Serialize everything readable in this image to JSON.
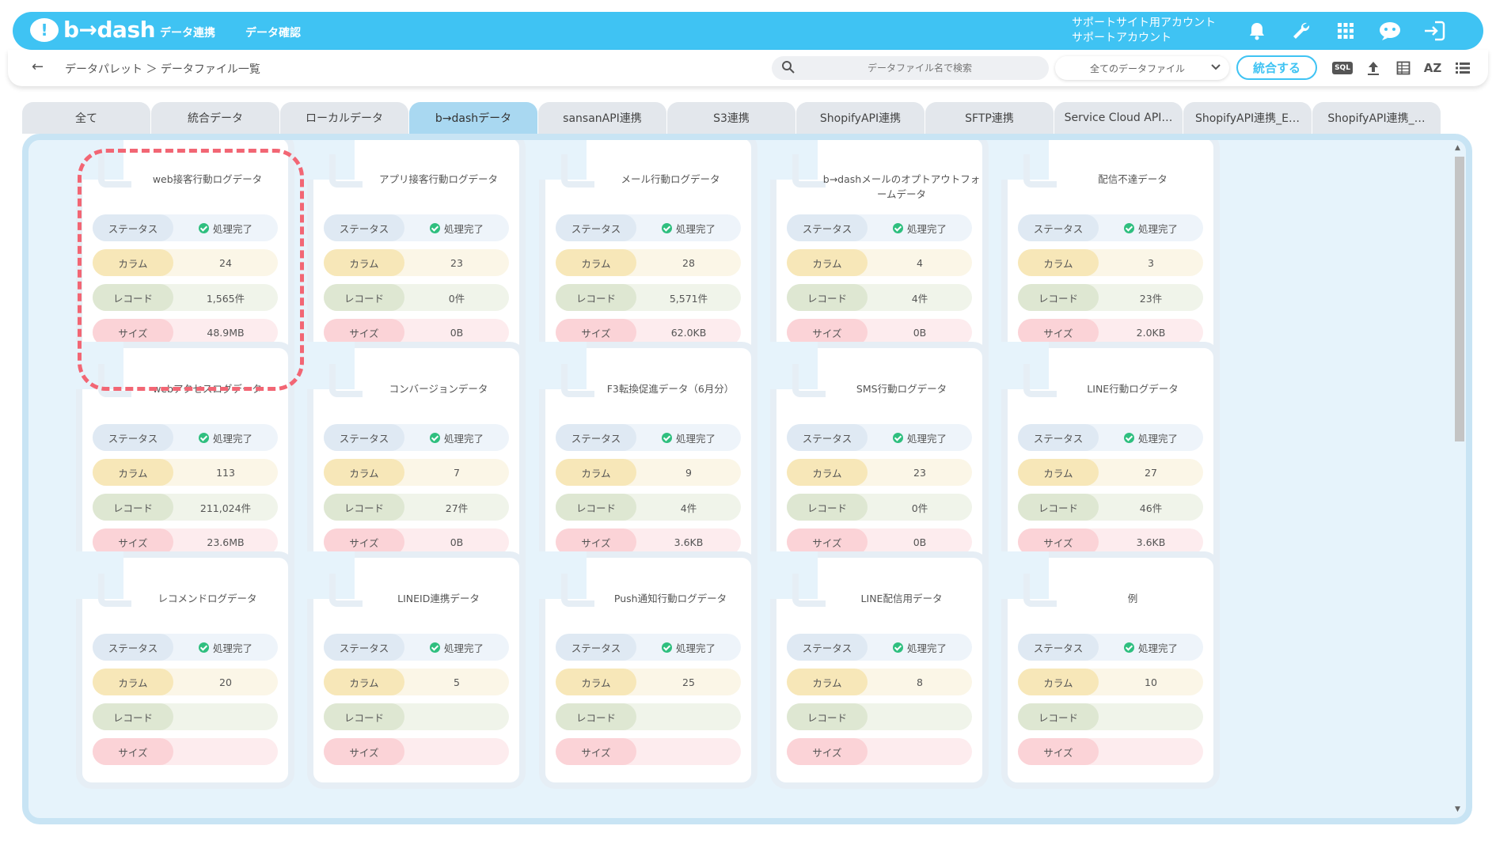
{
  "header": {
    "logo_mark": "!",
    "logo": "b→dash",
    "nav": [
      "データ連携",
      "データ確認"
    ],
    "account_line1": "サポートサイト用アカウント",
    "account_line2": "サポートアカウント",
    "icons": [
      "bell-icon",
      "wrench-icon",
      "grid-icon",
      "chat-bot-icon",
      "logout-icon"
    ]
  },
  "toolbar": {
    "breadcrumb": "データパレット ＞ データファイル一覧",
    "search_placeholder": "データファイル名で検索",
    "filter_selected": "全てのデータファイル",
    "merge_label": "統合する",
    "sql_label": "SQL",
    "sort_label": "AZ",
    "icons": [
      "sql-icon",
      "upload-icon",
      "table-view-icon",
      "sort-az-icon",
      "list-view-icon"
    ]
  },
  "tabs": [
    {
      "label": "全て",
      "active": false
    },
    {
      "label": "統合データ",
      "active": false
    },
    {
      "label": "ローカルデータ",
      "active": false
    },
    {
      "label": "b→dashデータ",
      "active": true
    },
    {
      "label": "sansanAPI連携",
      "active": false
    },
    {
      "label": "S3連携",
      "active": false
    },
    {
      "label": "ShopifyAPI連携",
      "active": false
    },
    {
      "label": "SFTP連携",
      "active": false
    },
    {
      "label": "Service Cloud API…",
      "active": false
    },
    {
      "label": "ShopifyAPI連携_E…",
      "active": false
    },
    {
      "label": "ShopifyAPI連携_…",
      "active": false
    }
  ],
  "labels": {
    "status": "ステータス",
    "columns": "カラム",
    "records": "レコード",
    "size": "サイズ"
  },
  "cards": [
    {
      "title": "web接客行動ログデータ",
      "status": "処理完了",
      "columns": "24",
      "records": "1,565件",
      "size": "48.9MB",
      "highlighted": true
    },
    {
      "title": "アプリ接客行動ログデータ",
      "status": "処理完了",
      "columns": "23",
      "records": "0件",
      "size": "0B"
    },
    {
      "title": "メール行動ログデータ",
      "status": "処理完了",
      "columns": "28",
      "records": "5,571件",
      "size": "62.0KB"
    },
    {
      "title": "b→dashメールのオプトアウトフォームデータ",
      "status": "処理完了",
      "columns": "4",
      "records": "4件",
      "size": "0B"
    },
    {
      "title": "配信不達データ",
      "status": "処理完了",
      "columns": "3",
      "records": "23件",
      "size": "2.0KB"
    },
    {
      "title": "webアクセスログデータ",
      "status": "処理完了",
      "columns": "113",
      "records": "211,024件",
      "size": "23.6MB"
    },
    {
      "title": "コンバージョンデータ",
      "status": "処理完了",
      "columns": "7",
      "records": "27件",
      "size": "0B"
    },
    {
      "title": "F3転換促進データ（6月分）",
      "status": "処理完了",
      "columns": "9",
      "records": "4件",
      "size": "3.6KB"
    },
    {
      "title": "SMS行動ログデータ",
      "status": "処理完了",
      "columns": "23",
      "records": "0件",
      "size": "0B"
    },
    {
      "title": "LINE行動ログデータ",
      "status": "処理完了",
      "columns": "27",
      "records": "46件",
      "size": "3.6KB"
    },
    {
      "title": "レコメンドログデータ",
      "status": "処理完了",
      "columns": "20",
      "records": "",
      "size": ""
    },
    {
      "title": "LINEID連携データ",
      "status": "処理完了",
      "columns": "5",
      "records": "",
      "size": ""
    },
    {
      "title": "Push通知行動ログデータ",
      "status": "処理完了",
      "columns": "25",
      "records": "",
      "size": ""
    },
    {
      "title": "LINE配信用データ",
      "status": "処理完了",
      "columns": "8",
      "records": "",
      "size": ""
    },
    {
      "title": "例",
      "status": "処理完了",
      "columns": "10",
      "records": "",
      "size": ""
    }
  ]
}
